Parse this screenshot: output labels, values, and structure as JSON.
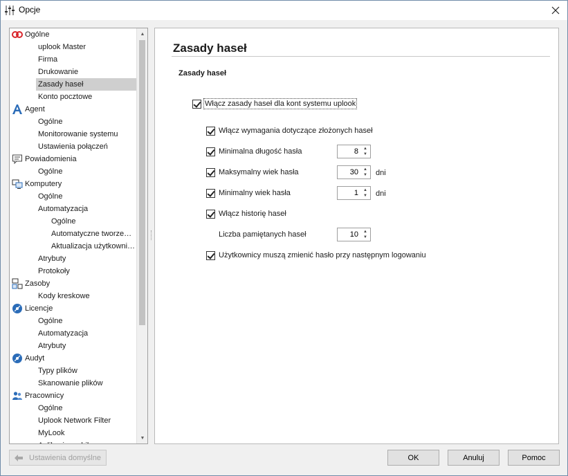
{
  "window": {
    "title": "Opcje"
  },
  "tree": {
    "items": [
      {
        "label": "Ogólne",
        "level": 0,
        "icon": "ogolne-logo-icon"
      },
      {
        "label": "uplook Master",
        "level": 1
      },
      {
        "label": "Firma",
        "level": 1
      },
      {
        "label": "Drukowanie",
        "level": 1
      },
      {
        "label": "Zasady haseł",
        "level": 1,
        "selected": true
      },
      {
        "label": "Konto pocztowe",
        "level": 1
      },
      {
        "label": "Agent",
        "level": 0,
        "icon": "agent-a-icon"
      },
      {
        "label": "Ogólne",
        "level": 1
      },
      {
        "label": "Monitorowanie systemu",
        "level": 1
      },
      {
        "label": "Ustawienia połączeń",
        "level": 1
      },
      {
        "label": "Powiadomienia",
        "level": 0,
        "icon": "notification-icon"
      },
      {
        "label": "Ogólne",
        "level": 1
      },
      {
        "label": "Komputery",
        "level": 0,
        "icon": "computers-icon"
      },
      {
        "label": "Ogólne",
        "level": 1
      },
      {
        "label": "Automatyzacja",
        "level": 1
      },
      {
        "label": "Ogólne",
        "level": 2
      },
      {
        "label": "Automatyczne tworze…",
        "level": 2
      },
      {
        "label": "Aktualizacja użytkowni…",
        "level": 2
      },
      {
        "label": "Atrybuty",
        "level": 1
      },
      {
        "label": "Protokoły",
        "level": 1
      },
      {
        "label": "Zasoby",
        "level": 0,
        "icon": "resources-icon"
      },
      {
        "label": "Kody kreskowe",
        "level": 1
      },
      {
        "label": "Licencje",
        "level": 0,
        "icon": "licenses-disc-icon"
      },
      {
        "label": "Ogólne",
        "level": 1
      },
      {
        "label": "Automatyzacja",
        "level": 1
      },
      {
        "label": "Atrybuty",
        "level": 1
      },
      {
        "label": "Audyt",
        "level": 0,
        "icon": "audit-disc-icon"
      },
      {
        "label": "Typy plików",
        "level": 1
      },
      {
        "label": "Skanowanie plików",
        "level": 1
      },
      {
        "label": "Pracownicy",
        "level": 0,
        "icon": "employees-icon"
      },
      {
        "label": "Ogólne",
        "level": 1
      },
      {
        "label": "Uplook Network Filter",
        "level": 1
      },
      {
        "label": "MyLook",
        "level": 1
      },
      {
        "label": "Aplikacja mobilna…",
        "level": 1
      }
    ]
  },
  "content": {
    "page_title": "Zasady haseł",
    "section_title": "Zasady haseł",
    "enable_policies": {
      "label": "Włącz zasady haseł dla kont systemu uplook",
      "checked": true
    },
    "complex_req": {
      "label": "Włącz wymagania dotyczące złożonych haseł",
      "checked": true
    },
    "min_length": {
      "label": "Minimalna długość hasła",
      "checked": true,
      "value": "8"
    },
    "max_age": {
      "label": "Maksymalny wiek hasła",
      "checked": true,
      "value": "30",
      "unit": "dni"
    },
    "min_age": {
      "label": "Minimalny wiek hasła",
      "checked": true,
      "value": "1",
      "unit": "dni"
    },
    "history": {
      "label": "Włącz historię haseł",
      "checked": true
    },
    "remembered": {
      "label": "Liczba pamiętanych haseł",
      "value": "10"
    },
    "must_change": {
      "label": "Użytkownicy muszą zmienić hasło przy następnym logowaniu",
      "checked": true
    }
  },
  "footer": {
    "defaults_label": "Ustawienia domyślne",
    "ok_label": "OK",
    "cancel_label": "Anuluj",
    "help_label": "Pomoc"
  }
}
